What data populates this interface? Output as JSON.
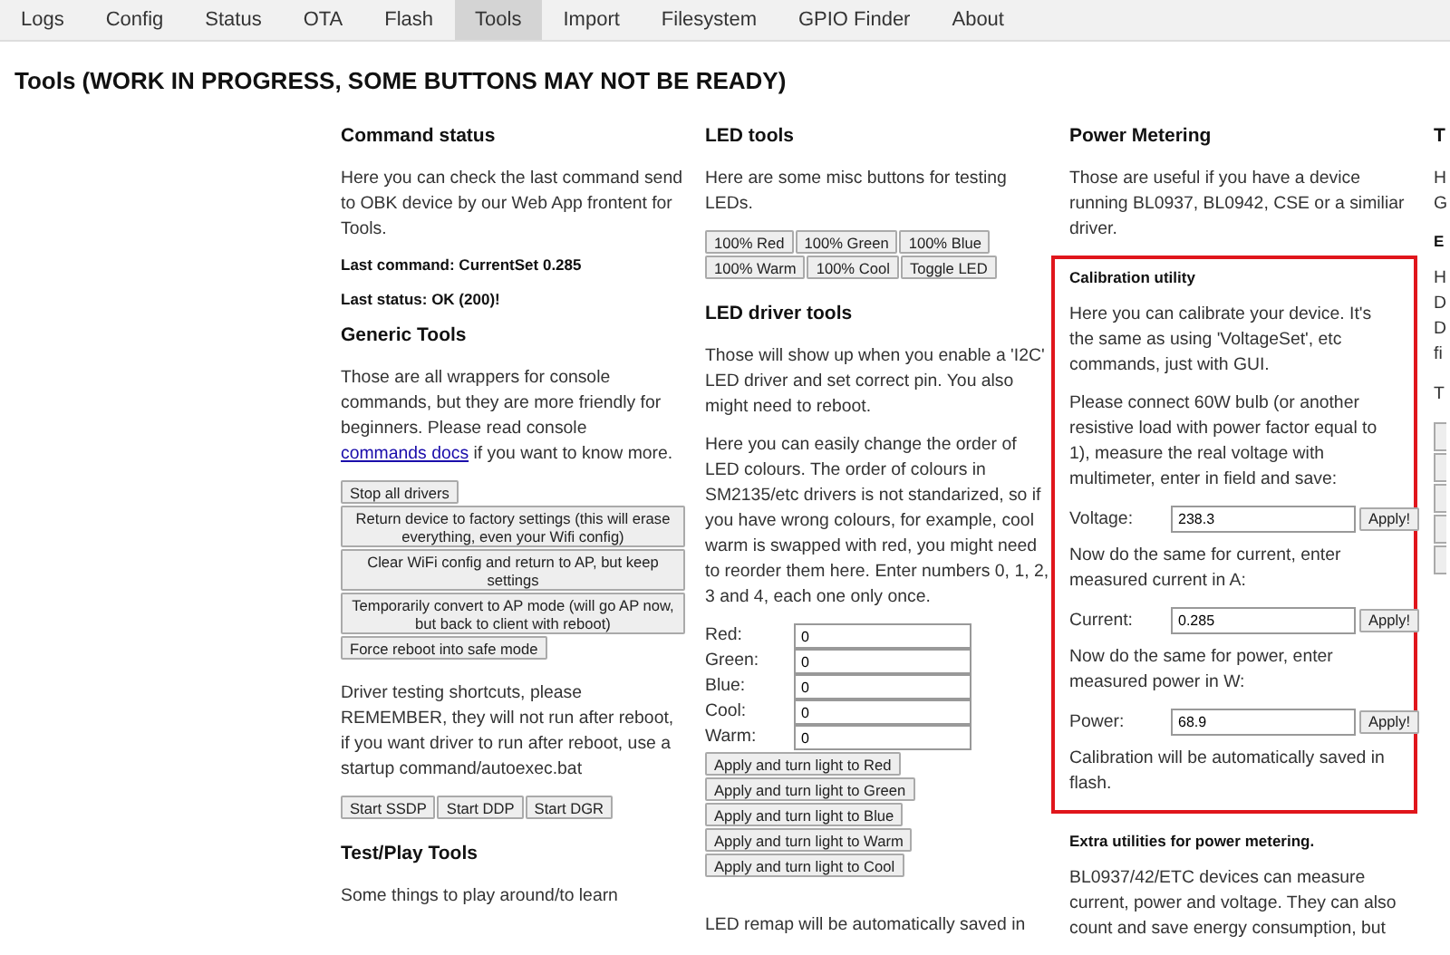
{
  "tabs": [
    {
      "label": "Logs",
      "selected": false
    },
    {
      "label": "Config",
      "selected": false
    },
    {
      "label": "Status",
      "selected": false
    },
    {
      "label": "OTA",
      "selected": false
    },
    {
      "label": "Flash",
      "selected": false
    },
    {
      "label": "Tools",
      "selected": true
    },
    {
      "label": "Import",
      "selected": false
    },
    {
      "label": "Filesystem",
      "selected": false
    },
    {
      "label": "GPIO Finder",
      "selected": false
    },
    {
      "label": "About",
      "selected": false
    }
  ],
  "title": "Tools (WORK IN PROGRESS, SOME BUTTONS MAY NOT BE READY)",
  "columns": [
    {
      "items": [
        {
          "kind": "heading",
          "text": "Command status"
        },
        {
          "kind": "paragraph",
          "text": "Here you can check the last command send to OBK device by our Web App frontent for Tools."
        },
        {
          "kind": "small_heading",
          "text": "Last command: CurrentSet 0.285"
        },
        {
          "kind": "small_heading",
          "text": "Last status: OK (200)!"
        },
        {
          "kind": "heading",
          "text": "Generic Tools"
        },
        {
          "kind": "paragraph",
          "text": "Those are all wrappers for console commands, but they are more friendly for beginners. Please read console ",
          "link": "commands docs",
          "after": " if you want to know more."
        },
        {
          "kind": "button_stack",
          "buttons": [
            {
              "label": "Stop all drivers",
              "wide": false
            },
            {
              "label": "Return device to factory settings (this will erase everything, even your Wifi config)",
              "wide": true
            },
            {
              "label": "Clear WiFi config and return to AP, but keep settings",
              "wide": true
            },
            {
              "label": "Temporarily convert to AP mode (will go AP now, but back to client with reboot)",
              "wide": true
            },
            {
              "label": "Force reboot into safe mode",
              "wide": false
            }
          ]
        },
        {
          "kind": "paragraph",
          "text": "Driver testing shortcuts, please REMEMBER, they will not run after reboot, if you want driver to run after reboot, use a startup command/autoexec.bat"
        },
        {
          "kind": "button_row",
          "buttons": [
            "Start SSDP",
            "Start DDP",
            "Start DGR"
          ]
        },
        {
          "kind": "heading",
          "text": "Test/Play Tools"
        },
        {
          "kind": "paragraph",
          "text": "Some things to play around/to learn"
        }
      ]
    },
    {
      "items": [
        {
          "kind": "heading",
          "text": "LED tools"
        },
        {
          "kind": "paragraph",
          "text": "Here are some misc buttons for testing LEDs."
        },
        {
          "kind": "button_row",
          "buttons": [
            "100% Red",
            "100% Green",
            "100% Blue",
            "100% Warm",
            "100% Cool",
            "Toggle LED"
          ]
        },
        {
          "kind": "heading",
          "text": "LED driver tools"
        },
        {
          "kind": "paragraph",
          "text": "Those will show up when you enable a 'I2C' LED driver and set correct pin. You also might need to reboot."
        },
        {
          "kind": "paragraph",
          "text": "Here you can easily change the order of LED colours. The order of colours in SM2135/etc drivers is not standarized, so if you have wrong colours, for example, cool warm is swapped with red, you might need to reorder them here. Enter numbers 0, 1, 2, 3 and 4, each one only once."
        },
        {
          "kind": "inputs",
          "rows": [
            {
              "label": "Red:",
              "value": "0"
            },
            {
              "label": "Green:",
              "value": "0"
            },
            {
              "label": "Blue:",
              "value": "0"
            },
            {
              "label": "Cool:",
              "value": "0"
            },
            {
              "label": "Warm:",
              "value": "0"
            }
          ]
        },
        {
          "kind": "button_stack",
          "buttons": [
            {
              "label": "Apply and turn light to Red",
              "wide": false
            },
            {
              "label": "Apply and turn light to Green",
              "wide": false
            },
            {
              "label": "Apply and turn light to Blue",
              "wide": false
            },
            {
              "label": "Apply and turn light to Warm",
              "wide": false
            },
            {
              "label": "Apply and turn light to Cool",
              "wide": false
            }
          ]
        },
        {
          "kind": "note",
          "text": "LED remap will be automatically saved in"
        }
      ]
    },
    {
      "items": [
        {
          "kind": "heading",
          "text": "Power Metering"
        },
        {
          "kind": "paragraph",
          "text": "Those are useful if you have a device running BL0937, BL0942, CSE or a similiar driver."
        },
        {
          "kind": "calibration",
          "items": [
            {
              "kind": "small_heading",
              "text": "Calibration utility"
            },
            {
              "kind": "paragraph",
              "text": "Here you can calibrate your device. It's the same as using 'VoltageSet', etc commands, just with GUI."
            },
            {
              "kind": "paragraph",
              "text": "Please connect 60W bulb (or another resistive load with power factor equal to 1), measure the real voltage with multimeter, enter in field and save:"
            },
            {
              "kind": "field",
              "label": "Voltage:",
              "value": "238.3",
              "button": "Apply!"
            },
            {
              "kind": "paragraph",
              "text": "Now do the same for current, enter measured current in A:"
            },
            {
              "kind": "field",
              "label": "Current:",
              "value": "0.285",
              "button": "Apply!"
            },
            {
              "kind": "paragraph",
              "text": "Now do the same for power, enter measured power in W:"
            },
            {
              "kind": "field",
              "label": "Power:",
              "value": "68.9",
              "button": "Apply!"
            },
            {
              "kind": "paragraph",
              "text": "Calibration will be automatically saved in flash."
            }
          ]
        },
        {
          "kind": "small_heading",
          "text": "Extra utilities for power metering."
        },
        {
          "kind": "paragraph",
          "text": "BL0937/42/ETC devices can measure current, power and voltage. They can also count and save energy consumption, but"
        }
      ]
    },
    {
      "items": [
        {
          "kind": "heading",
          "text": "T"
        },
        {
          "kind": "lines",
          "lines": [
            "H",
            "G"
          ]
        },
        {
          "kind": "small_heading",
          "text": "E"
        },
        {
          "kind": "lines",
          "lines": [
            "H",
            "D",
            "D",
            "fi"
          ]
        },
        {
          "kind": "lines",
          "lines": [
            "T"
          ]
        },
        {
          "kind": "button_stubs"
        }
      ]
    }
  ]
}
